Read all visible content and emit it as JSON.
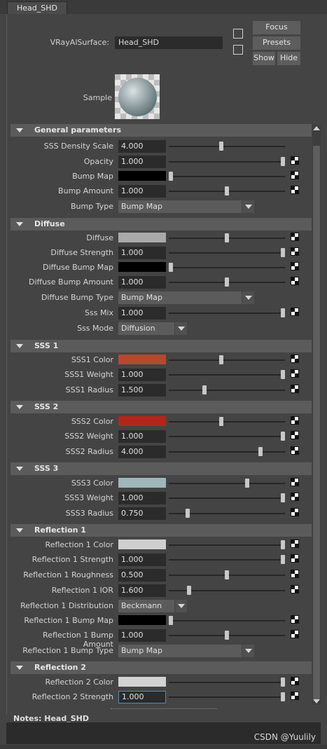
{
  "tab": "Head_SHD",
  "surface_label": "VRayAlSurface:",
  "surface_name": "Head_SHD",
  "buttons": {
    "focus": "Focus",
    "presets": "Presets",
    "show": "Show",
    "hide": "Hide"
  },
  "sample_label": "Sample",
  "sections": {
    "general": "General parameters",
    "diffuse": "Diffuse",
    "sss1": "SSS 1",
    "sss2": "SSS 2",
    "sss3": "SSS 3",
    "refl1": "Reflection 1",
    "refl2": "Reflection 2"
  },
  "rows": {
    "sss_density_scale": {
      "label": "SSS Density Scale",
      "value": "4.000",
      "slider": 0.45
    },
    "opacity": {
      "label": "Opacity",
      "value": "1.000",
      "slider": 1.0
    },
    "bump_map": {
      "label": "Bump Map",
      "color": "#000000",
      "slider": 0.0
    },
    "bump_amount": {
      "label": "Bump Amount",
      "value": "1.000",
      "slider": 0.5
    },
    "bump_type": {
      "label": "Bump Type",
      "value": "Bump Map"
    },
    "diffuse": {
      "label": "Diffuse",
      "color": "#a9a9a9",
      "slider": 0.5
    },
    "diffuse_strength": {
      "label": "Diffuse Strength",
      "value": "1.000",
      "slider": 1.0
    },
    "diffuse_bump_map": {
      "label": "Diffuse Bump Map",
      "color": "#000000",
      "slider": 0.0
    },
    "diffuse_bump_amount": {
      "label": "Diffuse Bump Amount",
      "value": "1.000",
      "slider": 0.5
    },
    "diffuse_bump_type": {
      "label": "Diffuse Bump Type",
      "value": "Bump Map"
    },
    "sss_mix": {
      "label": "Sss Mix",
      "value": "1.000",
      "slider": 1.0
    },
    "sss_mode": {
      "label": "Sss Mode",
      "value": "Diffusion"
    },
    "sss1_color": {
      "label": "SSS1 Color",
      "color": "#b5492e",
      "slider": 0.45
    },
    "sss1_weight": {
      "label": "SSS1 Weight",
      "value": "1.000",
      "slider": 1.0
    },
    "sss1_radius": {
      "label": "SSS1 Radius",
      "value": "1.500",
      "slider": 0.3
    },
    "sss2_color": {
      "label": "SSS2 Color",
      "color": "#b2261a",
      "slider": 0.45
    },
    "sss2_weight": {
      "label": "SSS2 Weight",
      "value": "1.000",
      "slider": 1.0
    },
    "sss2_radius": {
      "label": "SSS2 Radius",
      "value": "4.000",
      "slider": 0.8
    },
    "sss3_color": {
      "label": "SSS3 Color",
      "color": "#9fb6bb",
      "slider": 0.68
    },
    "sss3_weight": {
      "label": "SSS3 Weight",
      "value": "1.000",
      "slider": 1.0
    },
    "sss3_radius": {
      "label": "SSS3 Radius",
      "value": "0.750",
      "slider": 0.15
    },
    "refl1_color": {
      "label": "Reflection 1 Color",
      "color": "#cfcfcf",
      "slider": 1.0
    },
    "refl1_strength": {
      "label": "Reflection 1 Strength",
      "value": "1.000",
      "slider": 1.0
    },
    "refl1_roughness": {
      "label": "Reflection 1 Roughness",
      "value": "0.500",
      "slider": 0.5
    },
    "refl1_ior": {
      "label": "Reflection 1 IOR",
      "value": "1.600",
      "slider": 0.16
    },
    "refl1_distribution": {
      "label": "Reflection 1 Distribution",
      "value": "Beckmann"
    },
    "refl1_bump_map": {
      "label": "Reflection 1 Bump Map",
      "color": "#000000",
      "slider": 0.0
    },
    "refl1_bump_amount": {
      "label": "Reflection 1 Bump Amount",
      "value": "1.000",
      "slider": 0.5
    },
    "refl1_bump_type": {
      "label": "Reflection 1 Bump Type",
      "value": "Bump Map"
    },
    "refl2_color": {
      "label": "Reflection 2 Color",
      "color": "#d2d2d2",
      "slider": 1.0
    },
    "refl2_strength": {
      "label": "Reflection 2 Strength",
      "value": "1.000",
      "slider": 1.0
    }
  },
  "notes_label": "Notes:  Head_SHD",
  "watermark": "CSDN @Yuulily"
}
